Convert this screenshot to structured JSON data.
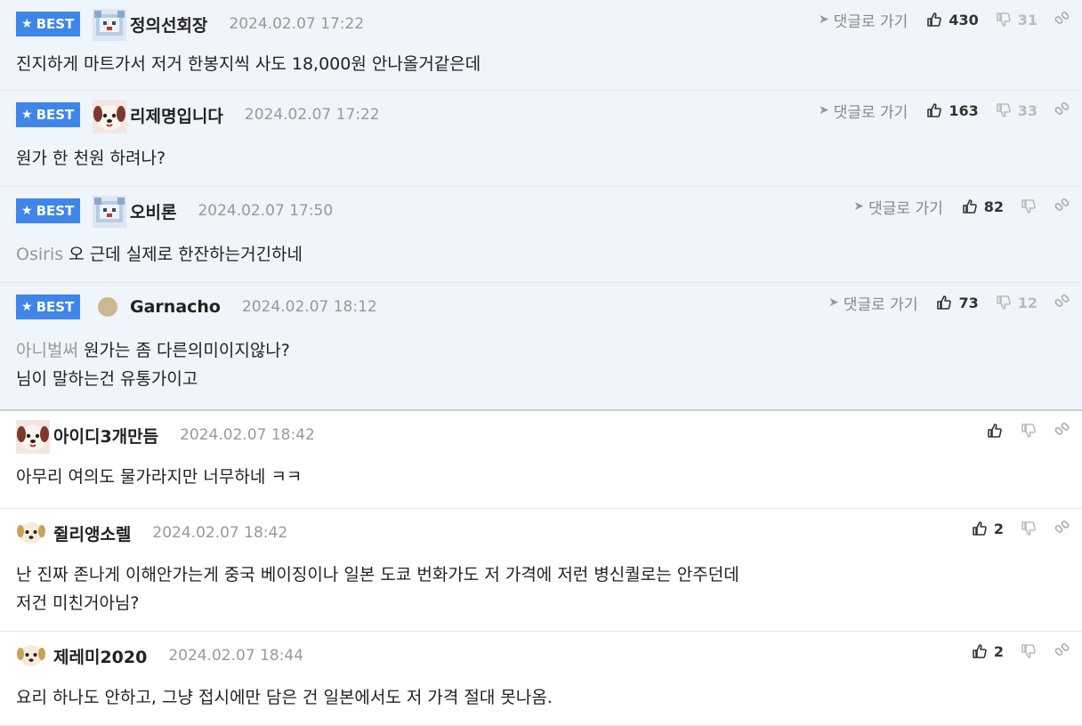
{
  "labels": {
    "best": "BEST",
    "goto": "댓글로 가기"
  },
  "comments": [
    {
      "best": true,
      "avatar": "pixel-dog-icon",
      "nick": "정의선회장",
      "date": "2024.02.07 17:22",
      "up": "430",
      "down": "31",
      "mention": "",
      "lines": [
        "진지하게 마트가서 저거 한봉지씩 사도 18,000원 안나올거같은데"
      ]
    },
    {
      "best": true,
      "avatar": "puppy-face-icon",
      "nick": "리제명입니다",
      "date": "2024.02.07 17:22",
      "up": "163",
      "down": "33",
      "mention": "",
      "lines": [
        "원가 한 천원 하려나?"
      ]
    },
    {
      "best": true,
      "avatar": "pixel-dog-icon",
      "nick": "오비론",
      "date": "2024.02.07 17:50",
      "up": "82",
      "down": "",
      "mention": "Osiris",
      "lines": [
        "오 근데 실제로 한잔하는거긴하네"
      ]
    },
    {
      "best": true,
      "avatar": "round-dot-icon",
      "nick": "Garnacho",
      "date": "2024.02.07 18:12",
      "up": "73",
      "down": "12",
      "mention": "아니벌써",
      "lines": [
        "원가는 좀 다른의미이지않나?",
        "님이 말하는건 유통가이고"
      ]
    },
    {
      "best": false,
      "avatar": "puppy-face-icon",
      "nick": "아이디3개만듬",
      "date": "2024.02.07 18:42",
      "up": "",
      "down": "",
      "mention": "",
      "lines": [
        "아무리 여의도 물가라지만 너무하네 ㅋㅋ"
      ]
    },
    {
      "best": false,
      "avatar": "puppy-small-icon",
      "nick": "쥘리앵소렐",
      "date": "2024.02.07 18:42",
      "up": "2",
      "down": "",
      "mention": "",
      "lines": [
        "난 진짜 존나게 이해안가는게 중국 베이징이나 일본 도쿄 번화가도 저 가격에 저런 병신퀄로는 안주던데",
        "저건 미친거아님?"
      ]
    },
    {
      "best": false,
      "avatar": "puppy-small-icon",
      "nick": "제레미2020",
      "date": "2024.02.07 18:44",
      "up": "2",
      "down": "",
      "mention": "",
      "lines": [
        "요리 하나도 안하고, 그냥 접시에만 담은 건 일본에서도 저 가격 절대 못나옴."
      ]
    }
  ]
}
